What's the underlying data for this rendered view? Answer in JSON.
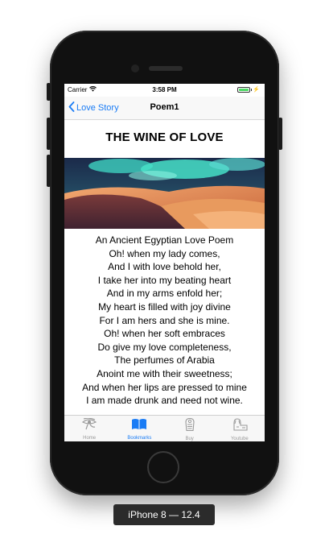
{
  "status_bar": {
    "carrier": "Carrier",
    "time": "3:58 PM"
  },
  "nav": {
    "back_label": "Love Story",
    "title": "Poem1"
  },
  "poem": {
    "title": "THE WINE OF LOVE",
    "lines": [
      "An Ancient Egyptian Love Poem",
      "Oh! when my lady comes,",
      "And I with love behold her,",
      "I take her into my beating heart",
      "And in my arms enfold her;",
      "My heart is filled with joy divine",
      "For I am hers and she is mine.",
      "Oh! when her soft embraces",
      "Do give my love completeness,",
      "The perfumes of Arabia",
      "Anoint me with their sweetness;",
      "And when her lips are pressed to mine",
      "I am made drunk and need not wine."
    ]
  },
  "tabs": [
    {
      "label": "Home",
      "icon": "eye-of-horus-icon",
      "active": false
    },
    {
      "label": "Bookmarks",
      "icon": "open-book-icon",
      "active": true
    },
    {
      "label": "Buy",
      "icon": "sarcophagus-icon",
      "active": false
    },
    {
      "label": "Youtube",
      "icon": "sphinx-icon",
      "active": false
    }
  ],
  "device_caption": "iPhone 8 — 12.4",
  "colors": {
    "accent": "#1a7cf5",
    "tab_inactive": "#9a9a9a",
    "battery": "#4cd964"
  }
}
